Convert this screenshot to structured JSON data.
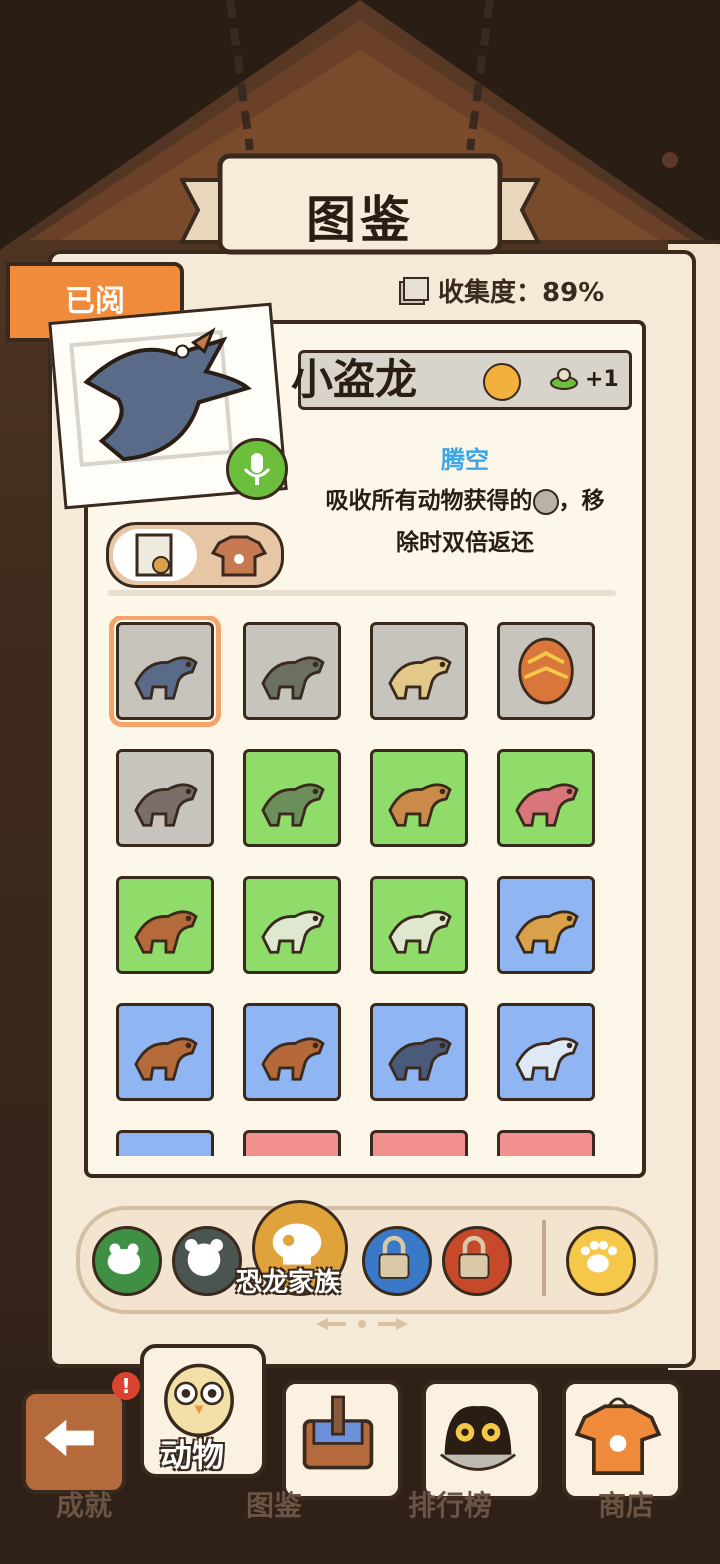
{
  "header": {
    "title": "图鉴"
  },
  "status": {
    "read_tag": "已阅",
    "collection_label": "收集度：",
    "collection_value": "89%"
  },
  "creature": {
    "name": "小盗龙",
    "bonus": "+1",
    "skill_name": "腾空",
    "skill_desc_line1": "吸收所有动物获得的",
    "skill_desc_mid": "，移",
    "skill_desc_line2": "除时双倍返还"
  },
  "colors": {
    "orange": "#f08b3c",
    "green_cell": "#8fdc6a",
    "blue_cell": "#8fb6f2",
    "grey_cell": "#c7c3bd",
    "pink_cell": "#f28f8f",
    "skill_blue": "#3aa6e8"
  },
  "grid": [
    {
      "name": "microraptor",
      "bg": "grey",
      "selected": true
    },
    {
      "name": "raptor",
      "bg": "grey"
    },
    {
      "name": "parasaurolophus",
      "bg": "grey"
    },
    {
      "name": "egg",
      "bg": "grey"
    },
    {
      "name": "bird-dino",
      "bg": "grey"
    },
    {
      "name": "triceratops",
      "bg": "green"
    },
    {
      "name": "crested-dino",
      "bg": "green"
    },
    {
      "name": "pink-dino",
      "bg": "green"
    },
    {
      "name": "oviraptor",
      "bg": "green"
    },
    {
      "name": "ankylosaurus-silhouette",
      "bg": "green"
    },
    {
      "name": "theropod-silhouette",
      "bg": "green"
    },
    {
      "name": "stegosaurus",
      "bg": "blue"
    },
    {
      "name": "dilophosaurus",
      "bg": "blue"
    },
    {
      "name": "therizinosaurus",
      "bg": "blue"
    },
    {
      "name": "brachiosaurus",
      "bg": "blue"
    },
    {
      "name": "ceratopsian-silhouette",
      "bg": "blue"
    },
    {
      "name": "partial-1",
      "bg": "blue"
    },
    {
      "name": "partial-2",
      "bg": "pink"
    },
    {
      "name": "partial-3",
      "bg": "pink"
    },
    {
      "name": "partial-4",
      "bg": "pink"
    }
  ],
  "category": {
    "active_label": "恐龙家族"
  },
  "tabs": {
    "active_label": "动物",
    "achieve": "成就",
    "atlas": "图鉴",
    "rank": "排行榜",
    "shop": "商店",
    "badge": "!"
  }
}
